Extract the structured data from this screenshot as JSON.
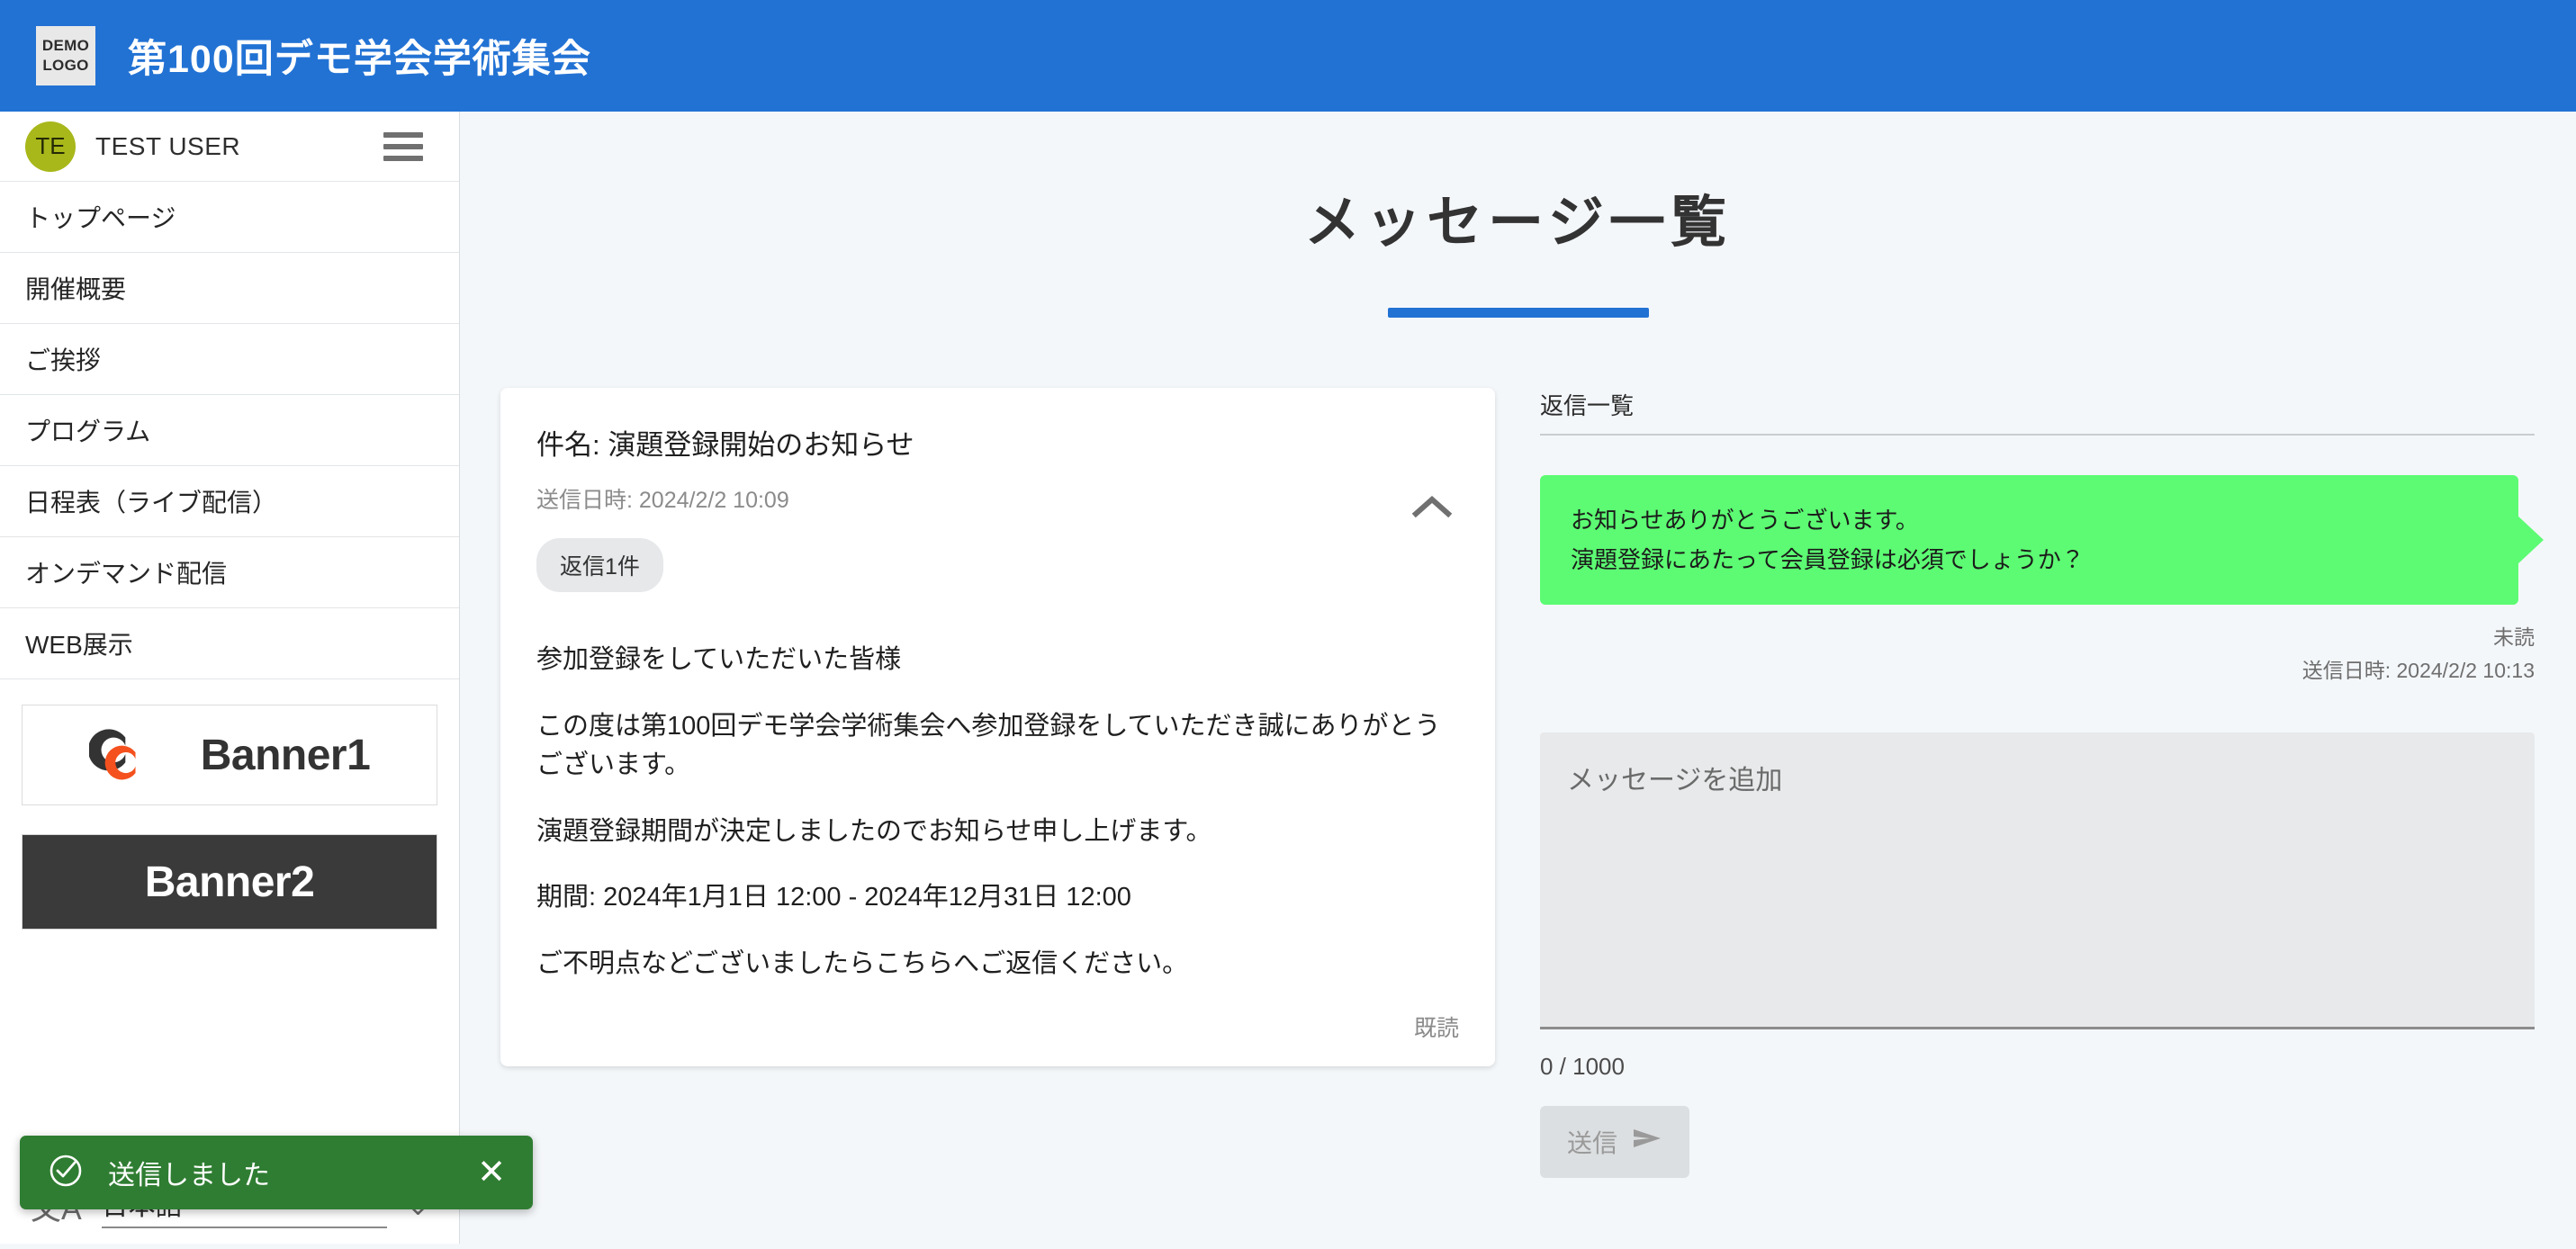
{
  "header": {
    "logo_line1": "DEMO",
    "logo_line2": "LOGO",
    "title": "第100回デモ学会学術集会",
    "brand_color": "#2272d4"
  },
  "sidebar": {
    "user": {
      "initials": "TE",
      "name": "TEST USER",
      "avatar_color": "#a8b71a"
    },
    "menu_icon": "hamburger-icon",
    "items": [
      {
        "label": "トップページ"
      },
      {
        "label": "開催概要"
      },
      {
        "label": "ご挨拶"
      },
      {
        "label": "プログラム"
      },
      {
        "label": "日程表（ライブ配信）"
      },
      {
        "label": "オンデマンド配信"
      },
      {
        "label": "WEB展示"
      }
    ],
    "banners": [
      {
        "label": "Banner1"
      },
      {
        "label": "Banner2"
      }
    ],
    "language": {
      "glyph": "文A",
      "value": "日本語",
      "caret": "⌄"
    }
  },
  "main": {
    "page_title": "メッセージ一覧",
    "message": {
      "subject_label": "件名:",
      "subject": "演題登録開始のお知らせ",
      "sent_label": "送信日時:",
      "sent_at": "2024/2/2 10:09",
      "reply_chip": "返信1件",
      "collapse_icon": "chevron-up-icon",
      "body": [
        "参加登録をしていただいた皆様",
        "この度は第100回デモ学会学術集会へ参加登録をしていただき誠にありがとうございます。",
        "演題登録期間が決定しましたのでお知らせ申し上げます。",
        "期間: 2024年1月1日 12:00 - 2024年12月31日 12:00",
        "ご不明点などございましたらこちらへご返信ください。"
      ],
      "read_status": "既読"
    },
    "replies": {
      "heading": "返信一覧",
      "items": [
        {
          "lines": [
            "お知らせありがとうございます。",
            "演題登録にあたって会員登録は必須でしょうか？"
          ],
          "status": "未読",
          "sent": "送信日時: 2024/2/2 10:13",
          "bubble_color": "#5cfb73"
        }
      ]
    },
    "composer": {
      "placeholder": "メッセージを追加",
      "value": "",
      "char_count": "0 / 1000",
      "send_label": "送信",
      "send_icon": "send-icon"
    }
  },
  "toast": {
    "icon": "check-circle-icon",
    "message": "送信しました",
    "close_icon": "close-icon",
    "color": "#2f7d32"
  }
}
